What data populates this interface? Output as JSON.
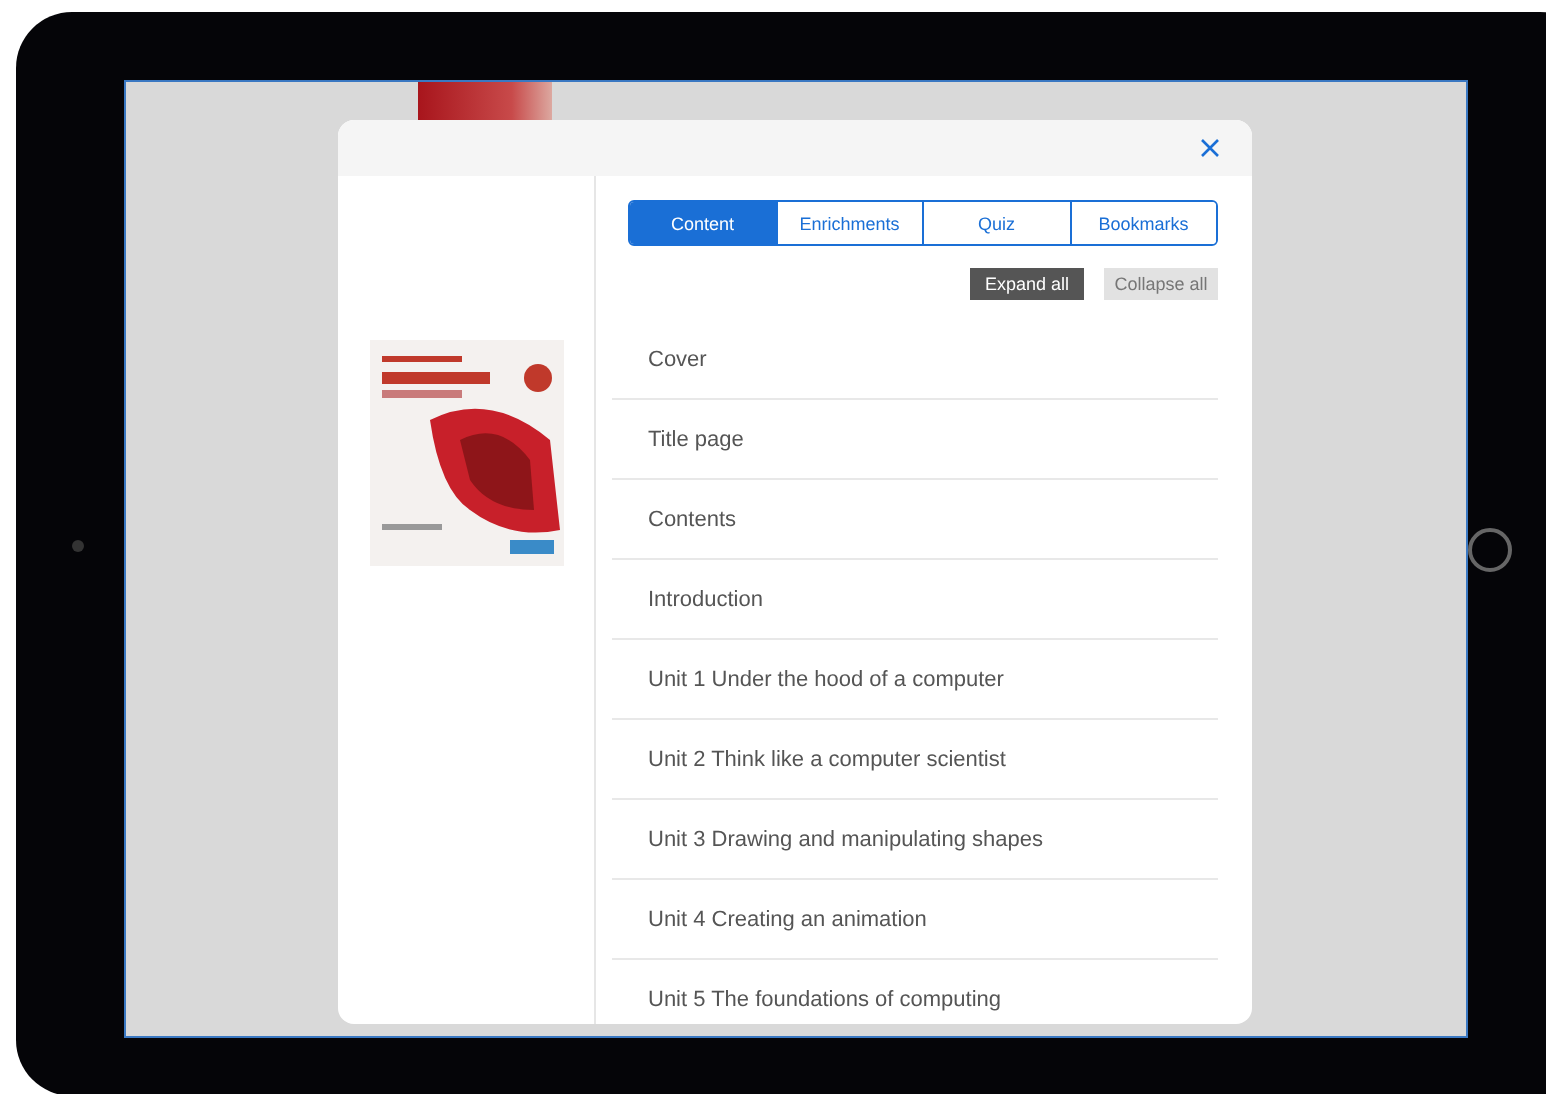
{
  "tabs": [
    {
      "label": "Content",
      "selected": true
    },
    {
      "label": "Enrichments",
      "selected": false
    },
    {
      "label": "Quiz",
      "selected": false
    },
    {
      "label": "Bookmarks",
      "selected": false
    }
  ],
  "actions": [
    {
      "label": "Expand all",
      "disabled": false
    },
    {
      "label": "Collapse all",
      "disabled": true
    }
  ],
  "contents": [
    {
      "title": "Cover"
    },
    {
      "title": "Title page"
    },
    {
      "title": "Contents"
    },
    {
      "title": "Introduction"
    },
    {
      "title": "Unit 1 Under the hood of a computer"
    },
    {
      "title": "Unit 2 Think like a computer scientist"
    },
    {
      "title": "Unit 3 Drawing and manipulating shapes"
    },
    {
      "title": "Unit 4 Creating an animation"
    },
    {
      "title": "Unit 5 The foundations of computing"
    }
  ]
}
